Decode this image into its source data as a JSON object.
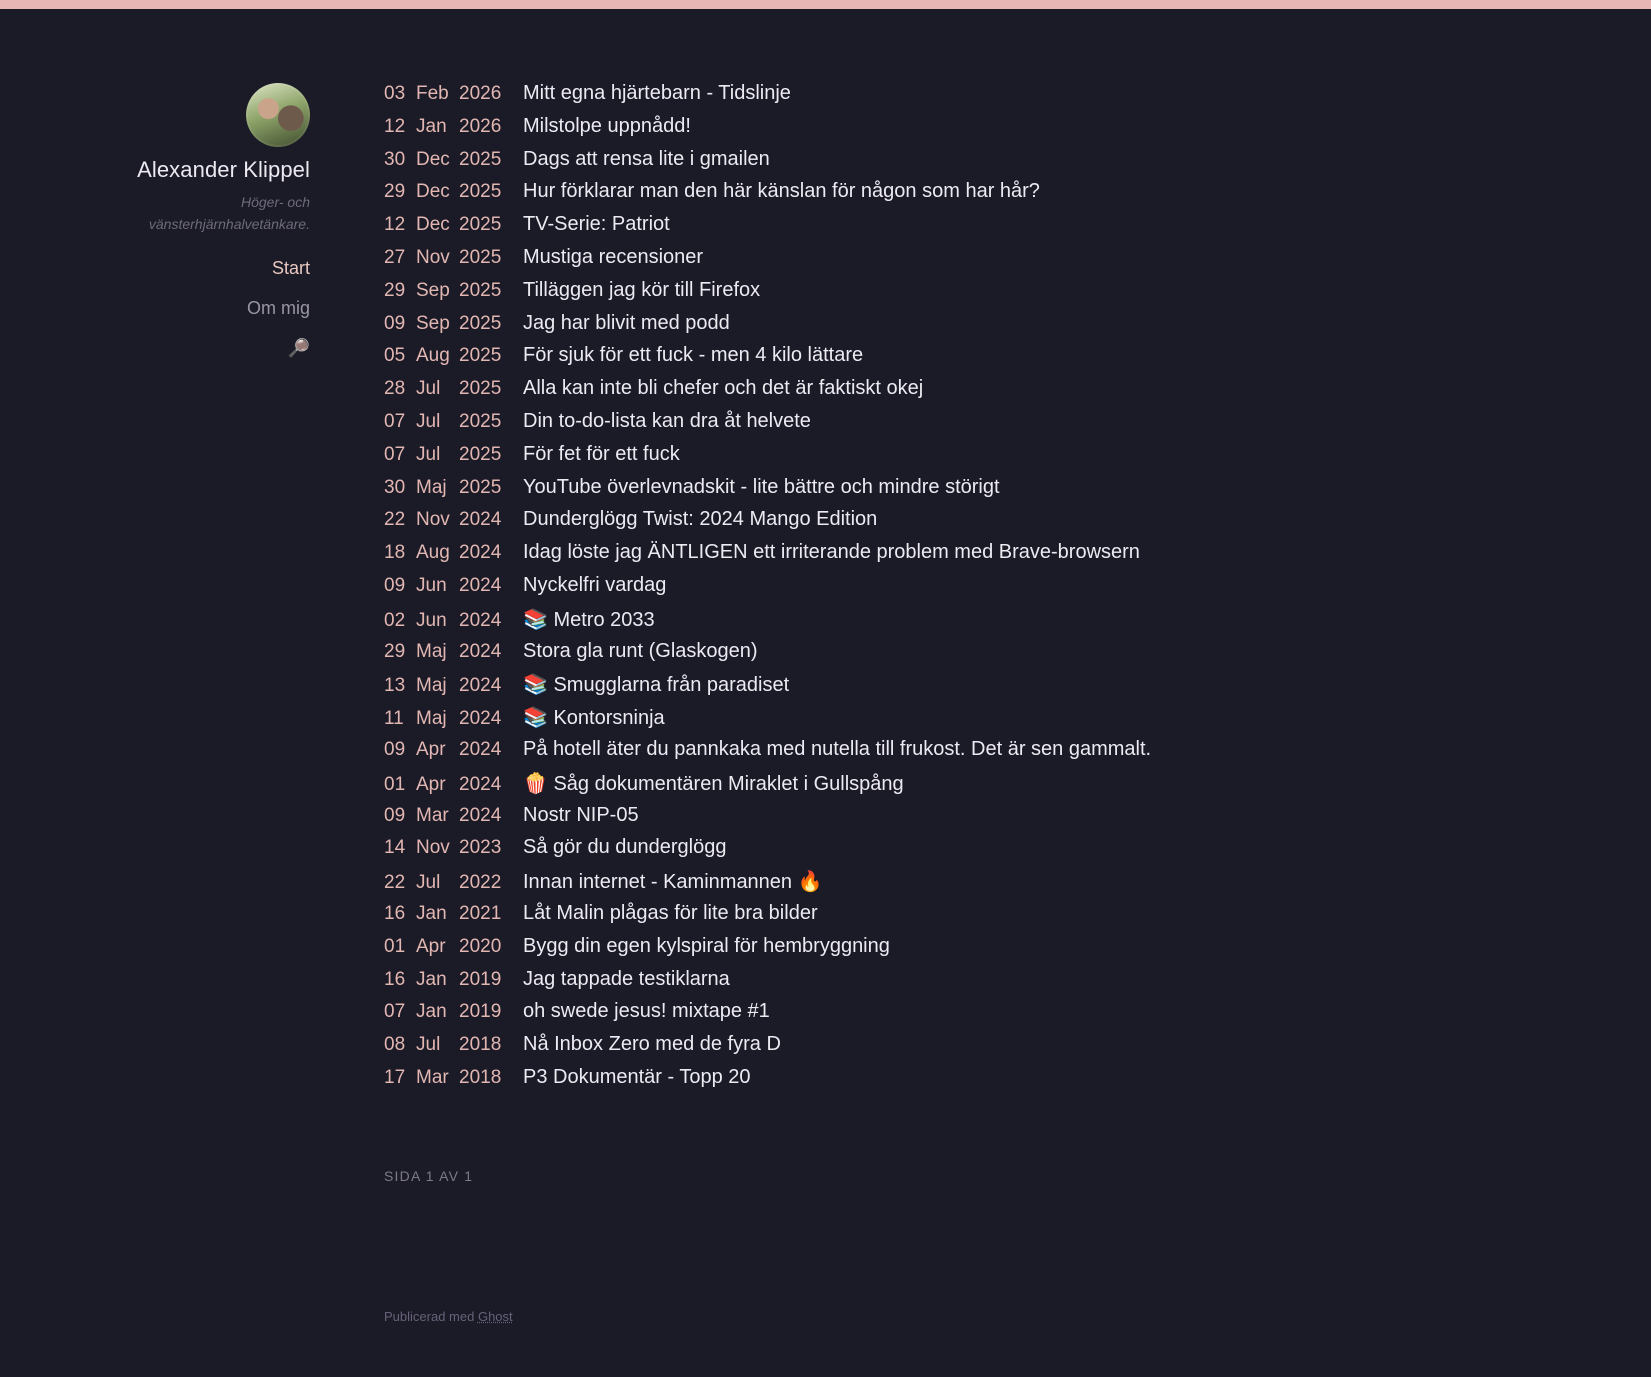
{
  "colors": {
    "accent_bar": "#e8b6b4",
    "background": "#1b1a27",
    "date": "#e2b7b2",
    "title": "#ecebf2"
  },
  "author": {
    "name": "Alexander Klippel",
    "tagline": "Höger- och vänsterhjärnhalvetänkare."
  },
  "nav": {
    "items": [
      {
        "label": "Start"
      },
      {
        "label": "Om mig"
      }
    ],
    "search_icon": "🔎"
  },
  "posts": [
    {
      "day": "03",
      "month": "Feb",
      "year": "2026",
      "title": "Mitt egna hjärtebarn - Tidslinje"
    },
    {
      "day": "12",
      "month": "Jan",
      "year": "2026",
      "title": "Milstolpe uppnådd!"
    },
    {
      "day": "30",
      "month": "Dec",
      "year": "2025",
      "title": "Dags att rensa lite i gmailen"
    },
    {
      "day": "29",
      "month": "Dec",
      "year": "2025",
      "title": "Hur förklarar man den här känslan för någon som har hår?"
    },
    {
      "day": "12",
      "month": "Dec",
      "year": "2025",
      "title": "TV-Serie: Patriot"
    },
    {
      "day": "27",
      "month": "Nov",
      "year": "2025",
      "title": "Mustiga recensioner"
    },
    {
      "day": "29",
      "month": "Sep",
      "year": "2025",
      "title": "Tilläggen jag kör till Firefox"
    },
    {
      "day": "09",
      "month": "Sep",
      "year": "2025",
      "title": "Jag har blivit med podd"
    },
    {
      "day": "05",
      "month": "Aug",
      "year": "2025",
      "title": "För sjuk för ett fuck - men 4 kilo lättare"
    },
    {
      "day": "28",
      "month": "Jul",
      "year": "2025",
      "title": "Alla kan inte bli chefer och det är faktiskt okej"
    },
    {
      "day": "07",
      "month": "Jul",
      "year": "2025",
      "title": "Din to-do-lista kan dra åt helvete"
    },
    {
      "day": "07",
      "month": "Jul",
      "year": "2025",
      "title": "För fet för ett fuck"
    },
    {
      "day": "30",
      "month": "Maj",
      "year": "2025",
      "title": "YouTube överlevnadskit - lite bättre och mindre störigt"
    },
    {
      "day": "22",
      "month": "Nov",
      "year": "2024",
      "title": "Dunderglögg Twist: 2024 Mango Edition"
    },
    {
      "day": "18",
      "month": "Aug",
      "year": "2024",
      "title": "Idag löste jag ÄNTLIGEN ett irriterande problem med Brave-browsern"
    },
    {
      "day": "09",
      "month": "Jun",
      "year": "2024",
      "title": "Nyckelfri vardag"
    },
    {
      "day": "02",
      "month": "Jun",
      "year": "2024",
      "title": "📚 Metro 2033"
    },
    {
      "day": "29",
      "month": "Maj",
      "year": "2024",
      "title": "Stora gla runt (Glaskogen)"
    },
    {
      "day": "13",
      "month": "Maj",
      "year": "2024",
      "title": "📚 Smugglarna från paradiset"
    },
    {
      "day": "11",
      "month": "Maj",
      "year": "2024",
      "title": "📚 Kontorsninja"
    },
    {
      "day": "09",
      "month": "Apr",
      "year": "2024",
      "title": "På hotell äter du pannkaka med nutella till frukost. Det är sen gammalt."
    },
    {
      "day": "01",
      "month": "Apr",
      "year": "2024",
      "title": "🍿 Såg dokumentären Miraklet i Gullspång"
    },
    {
      "day": "09",
      "month": "Mar",
      "year": "2024",
      "title": "Nostr NIP-05"
    },
    {
      "day": "14",
      "month": "Nov",
      "year": "2023",
      "title": "Så gör du dunderglögg"
    },
    {
      "day": "22",
      "month": "Jul",
      "year": "2022",
      "title": "Innan internet - Kaminmannen 🔥"
    },
    {
      "day": "16",
      "month": "Jan",
      "year": "2021",
      "title": "Låt Malin plågas för lite bra bilder"
    },
    {
      "day": "01",
      "month": "Apr",
      "year": "2020",
      "title": "Bygg din egen kylspiral för hembryggning"
    },
    {
      "day": "16",
      "month": "Jan",
      "year": "2019",
      "title": "Jag tappade testiklarna"
    },
    {
      "day": "07",
      "month": "Jan",
      "year": "2019",
      "title": "oh swede jesus! mixtape #1"
    },
    {
      "day": "08",
      "month": "Jul",
      "year": "2018",
      "title": "Nå Inbox Zero med de fyra D"
    },
    {
      "day": "17",
      "month": "Mar",
      "year": "2018",
      "title": "P3 Dokumentär - Topp 20"
    }
  ],
  "pagination": "SIDA 1 AV 1",
  "footer": {
    "prefix": "Publicerad med ",
    "link": "Ghost"
  }
}
